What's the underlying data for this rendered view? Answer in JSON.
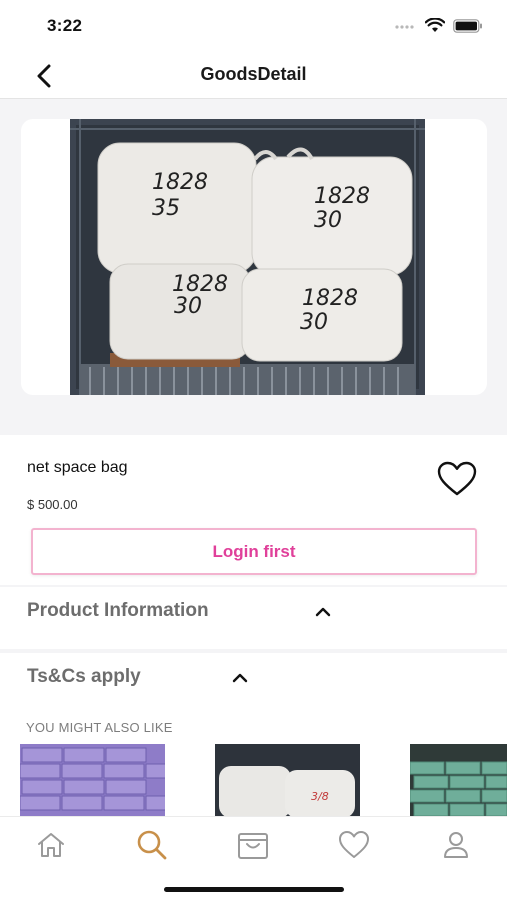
{
  "status_bar": {
    "time": "3:22"
  },
  "nav": {
    "title": "GoodsDetail",
    "back_icon": "chevron-left-icon"
  },
  "product": {
    "name": "net space bag",
    "price": "$ 500.00",
    "photo_bag_labels": [
      {
        "line1": "1828",
        "line2": "35"
      },
      {
        "line1": "1828",
        "line2": "30"
      },
      {
        "line1": "1828",
        "line2": "30"
      },
      {
        "line1": "1828",
        "line2": "30"
      }
    ]
  },
  "actions": {
    "login_label": "Login first",
    "favorite_icon": "heart-outline-icon"
  },
  "sections": [
    {
      "title": "Product Information",
      "icon": "chevron-up-icon"
    },
    {
      "title": "Ts&Cs apply",
      "icon": "chevron-up-icon"
    }
  ],
  "recommendations": {
    "title": "YOU MIGHT ALSO LIKE"
  },
  "tab_bar": {
    "tabs": [
      {
        "name": "home",
        "icon": "home-icon",
        "active": false
      },
      {
        "name": "search",
        "icon": "search-icon",
        "active": true
      },
      {
        "name": "cart",
        "icon": "bag-icon",
        "active": false
      },
      {
        "name": "favorites",
        "icon": "heart-icon",
        "active": false
      },
      {
        "name": "profile",
        "icon": "user-icon",
        "active": false
      }
    ]
  },
  "colors": {
    "accent_pink": "#e0409a",
    "active_tab": "#c8904a",
    "inactive_tab": "#9a9a9a",
    "section_text": "#6d6d6d"
  }
}
